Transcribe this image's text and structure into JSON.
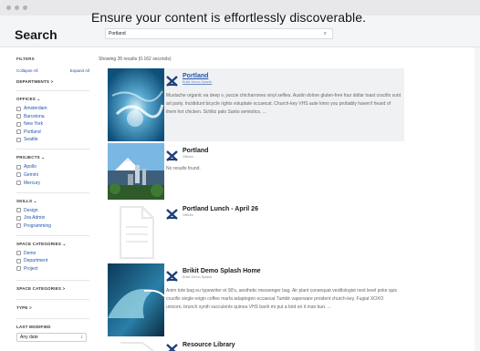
{
  "window": {
    "title": ""
  },
  "header": {
    "page_title": "Search",
    "tagline": "Ensure your content is effortlessly discoverable.",
    "search_value": "Portland"
  },
  "sidebar": {
    "filters_label": "FILTERS",
    "collapse_all": "Collapse All",
    "expand_all": "Expand All",
    "departments": "DEPARTMENTS >",
    "offices": {
      "title": "OFFICES ⌄",
      "items": [
        "Amsterdam",
        "Barcelona",
        "New York",
        "Portland",
        "Seattle"
      ]
    },
    "projects": {
      "title": "PROJECTS ⌄",
      "items": [
        "Apollo",
        "Gemini",
        "Mercury"
      ]
    },
    "skills": {
      "title": "SKILLS ⌄",
      "items": [
        "Design",
        "Jira Admin",
        "Programming"
      ]
    },
    "space_categories_open": {
      "title": "SPACE CATEGORIES ⌄",
      "items": [
        "Demo",
        "Department",
        "Project"
      ]
    },
    "space_categories_closed": "SPACE CATEGORIES >",
    "type": "TYPE >",
    "last_modified": "LAST MODIFIED",
    "last_modified_value": "Any date"
  },
  "results": {
    "summary": "Showing 35 results (0.162 seconds)",
    "items": [
      {
        "title": "Portland",
        "subtitle": "Brikit Demo Splash",
        "text": "Mustache organic ea deep v, yuccie chicharrones vinyl selfies. Austin dolore gluten-free four dollar toast crucifix sunt art party. Incididunt bicycle rights voluptate occaecat. Church-key VHS aute lomo you probably haven't heard of them hot chicken. Schlitz palo Santo semiotics, ..."
      },
      {
        "title": "Portland",
        "subtitle": "Offices",
        "text": "No results found."
      },
      {
        "title": "Portland Lunch - April 26",
        "subtitle": "Offices",
        "text": ""
      },
      {
        "title": "Brikit Demo Splash Home",
        "subtitle": "Brikit Demo Splash",
        "text": "Anim tote bag eu typewriter et 90's, aesthetic messenger bag. Air plant consequat vexillologist next level poke quis crucifix single-origin coffee marfa adaptogen occaecat Tumblr vaporware proident church-key. Fugiat XOXO unicorn, brunch synth succulents quinoa VHS banh mi put a bird on it man bun. ..."
      },
      {
        "title": "Resource Library",
        "subtitle": "",
        "text": ""
      }
    ]
  },
  "colors": {
    "link": "#2255aa",
    "header_bg": "#f3f5f7",
    "highlight_bg": "#f0f1f2"
  },
  "icons": {
    "search": "magnifier-icon",
    "logo": "brikit-logo-icon"
  }
}
